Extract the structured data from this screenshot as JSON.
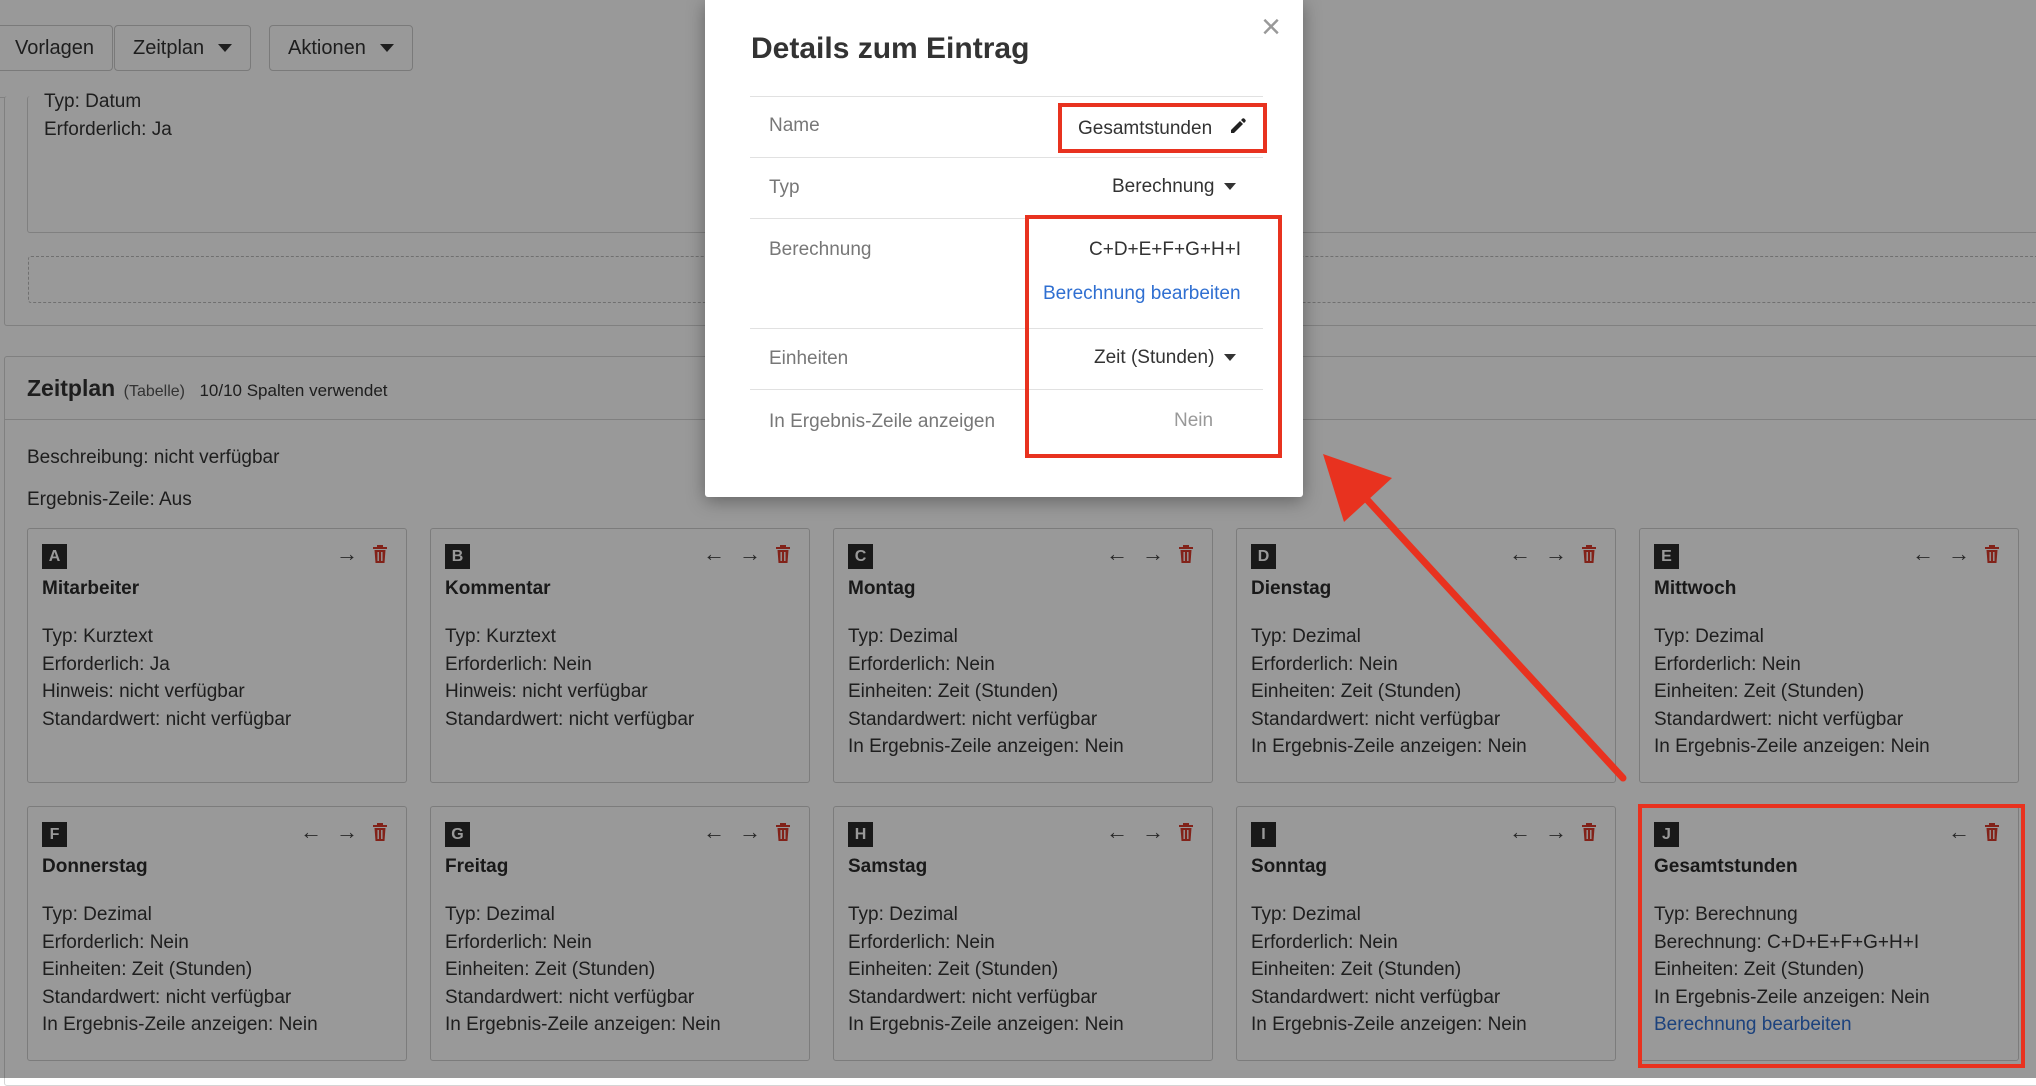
{
  "toolbar": {
    "vorlagen_label": "Vorlagen",
    "zeitplan_label": "Zeitplan",
    "aktionen_label": "Aktionen"
  },
  "upper_block": {
    "typ": "Typ: Datum",
    "erforderlich": "Erforderlich: Ja"
  },
  "section": {
    "title": "Zeitplan",
    "subtitle": "(Tabelle)",
    "columns_used": "10/10 Spalten verwendet",
    "beschreibung": "Beschreibung: nicht verfügbar",
    "ergebnis": "Ergebnis-Zeile: Aus"
  },
  "cards": [
    {
      "letter": "A",
      "title": "Mitarbeiter",
      "lines": [
        "Typ: Kurztext",
        "Erforderlich: Ja",
        "Hinweis: nicht verfügbar",
        "Standardwert: nicht verfügbar"
      ]
    },
    {
      "letter": "B",
      "title": "Kommentar",
      "lines": [
        "Typ: Kurztext",
        "Erforderlich: Nein",
        "Hinweis: nicht verfügbar",
        "Standardwert: nicht verfügbar"
      ]
    },
    {
      "letter": "C",
      "title": "Montag",
      "lines": [
        "Typ: Dezimal",
        "Erforderlich: Nein",
        "Einheiten: Zeit (Stunden)",
        "Standardwert: nicht verfügbar",
        "In Ergebnis-Zeile anzeigen: Nein"
      ]
    },
    {
      "letter": "D",
      "title": "Dienstag",
      "lines": [
        "Typ: Dezimal",
        "Erforderlich: Nein",
        "Einheiten: Zeit (Stunden)",
        "Standardwert: nicht verfügbar",
        "In Ergebnis-Zeile anzeigen: Nein"
      ]
    },
    {
      "letter": "E",
      "title": "Mittwoch",
      "lines": [
        "Typ: Dezimal",
        "Erforderlich: Nein",
        "Einheiten: Zeit (Stunden)",
        "Standardwert: nicht verfügbar",
        "In Ergebnis-Zeile anzeigen: Nein"
      ]
    },
    {
      "letter": "F",
      "title": "Donnerstag",
      "lines": [
        "Typ: Dezimal",
        "Erforderlich: Nein",
        "Einheiten: Zeit (Stunden)",
        "Standardwert: nicht verfügbar",
        "In Ergebnis-Zeile anzeigen: Nein"
      ]
    },
    {
      "letter": "G",
      "title": "Freitag",
      "lines": [
        "Typ: Dezimal",
        "Erforderlich: Nein",
        "Einheiten: Zeit (Stunden)",
        "Standardwert: nicht verfügbar",
        "In Ergebnis-Zeile anzeigen: Nein"
      ]
    },
    {
      "letter": "H",
      "title": "Samstag",
      "lines": [
        "Typ: Dezimal",
        "Erforderlich: Nein",
        "Einheiten: Zeit (Stunden)",
        "Standardwert: nicht verfügbar",
        "In Ergebnis-Zeile anzeigen: Nein"
      ]
    },
    {
      "letter": "I",
      "title": "Sonntag",
      "lines": [
        "Typ: Dezimal",
        "Erforderlich: Nein",
        "Einheiten: Zeit (Stunden)",
        "Standardwert: nicht verfügbar",
        "In Ergebnis-Zeile anzeigen: Nein"
      ]
    },
    {
      "letter": "J",
      "title": "Gesamtstunden",
      "lines": [
        "Typ: Berechnung",
        "Berechnung: C+D+E+F+G+H+I",
        "Einheiten: Zeit (Stunden)",
        "In Ergebnis-Zeile anzeigen: Nein"
      ],
      "link": "Berechnung bearbeiten"
    }
  ],
  "modal": {
    "title": "Details zum Eintrag",
    "close_icon": "×",
    "rows": {
      "name_label": "Name",
      "name_value": "Gesamtstunden",
      "typ_label": "Typ",
      "typ_value": "Berechnung",
      "berechnung_label": "Berechnung",
      "berechnung_value": "C+D+E+F+G+H+I",
      "berechnung_link": "Berechnung bearbeiten",
      "einheiten_label": "Einheiten",
      "einheiten_value": "Zeit (Stunden)",
      "ergebnis_label": "In Ergebnis-Zeile anzeigen",
      "ergebnis_value": "Nein"
    }
  },
  "icons": {
    "arrow_left": "←",
    "arrow_right": "→",
    "pencil": "pencil-icon",
    "trash": "trash-icon"
  },
  "colors": {
    "highlight_red": "#e8321f",
    "link_blue": "#2f6fd1",
    "trash_red": "#d9392b"
  }
}
